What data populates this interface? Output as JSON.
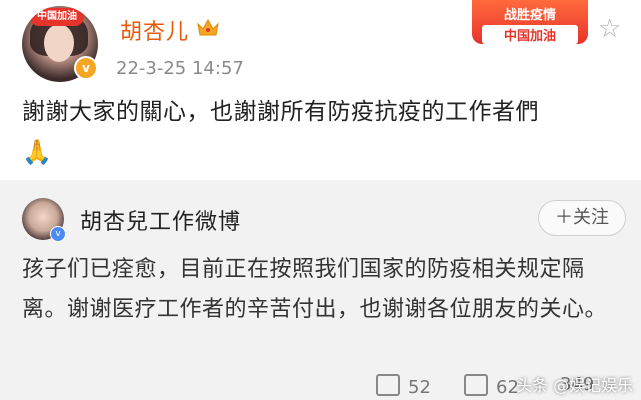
{
  "post": {
    "author": "胡杏儿",
    "timestamp": "22-3-25 14:57",
    "avatar_badge": "中国加油",
    "promo": {
      "line1": "战胜疫情",
      "line2": "中国加油"
    },
    "text": "謝謝大家的關心，也謝謝所有防疫抗疫的工作者們",
    "emoji": "🙏"
  },
  "quoted": {
    "author": "胡杏兒工作微博",
    "follow_label": "＋关注",
    "text": "孩子们已痊愈，目前正在按照我们国家的防疫相关规定隔离。谢谢医疗工作者的辛苦付出，也谢谢各位朋友的关心。"
  },
  "actions": {
    "repost_count": "52",
    "comment_count": "62",
    "like_count": "349"
  },
  "watermark": "头条 @娱记娱乐",
  "colors": {
    "username": "#e8590c",
    "promo_bg": "#e8332a",
    "quoted_bg": "#f2f2f2"
  },
  "icons": [
    "crown-icon",
    "star-icon",
    "verified-icon",
    "repost-icon",
    "comment-icon"
  ]
}
